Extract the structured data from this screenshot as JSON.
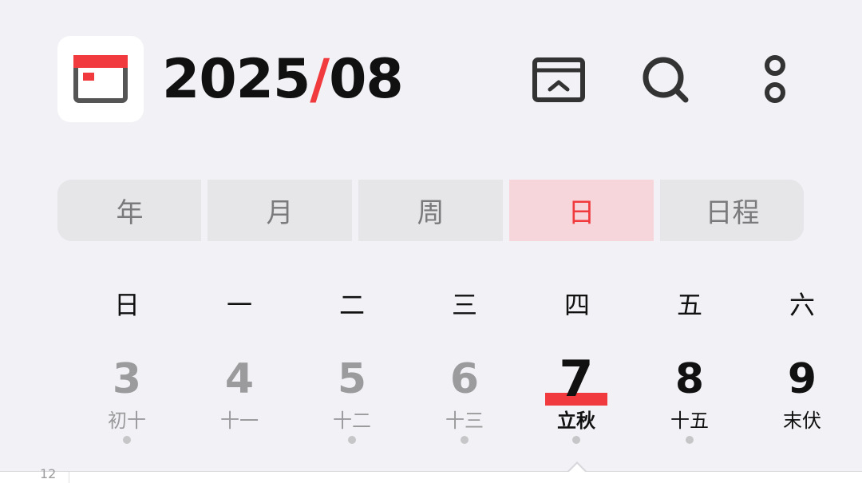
{
  "header": {
    "year": "2025",
    "separator": "/",
    "month": "08",
    "icons": [
      "calendar-app-icon",
      "today-box-icon",
      "search-icon",
      "more-icon"
    ]
  },
  "view_tabs": [
    {
      "label": "年",
      "active": false
    },
    {
      "label": "月",
      "active": false
    },
    {
      "label": "周",
      "active": false
    },
    {
      "label": "日",
      "active": true
    },
    {
      "label": "日程",
      "active": false
    }
  ],
  "weekdays": [
    "日",
    "一",
    "二",
    "三",
    "四",
    "五",
    "六"
  ],
  "days": [
    {
      "number": "3",
      "lunar": "初十",
      "state": "past",
      "has_dot": true
    },
    {
      "number": "4",
      "lunar": "十一",
      "state": "past",
      "has_dot": false
    },
    {
      "number": "5",
      "lunar": "十二",
      "state": "past",
      "has_dot": true
    },
    {
      "number": "6",
      "lunar": "十三",
      "state": "past",
      "has_dot": true
    },
    {
      "number": "7",
      "lunar": "立秋",
      "state": "today",
      "has_dot": true
    },
    {
      "number": "8",
      "lunar": "十五",
      "state": "future",
      "has_dot": true
    },
    {
      "number": "9",
      "lunar": "末伏",
      "state": "future",
      "has_dot": false
    }
  ],
  "timeline": {
    "hour_label": "12"
  },
  "colors": {
    "accent": "#f03a3d",
    "active_tab_bg": "#f6d6da",
    "background": "#f2f1f5",
    "muted": "#9b9b9d"
  }
}
